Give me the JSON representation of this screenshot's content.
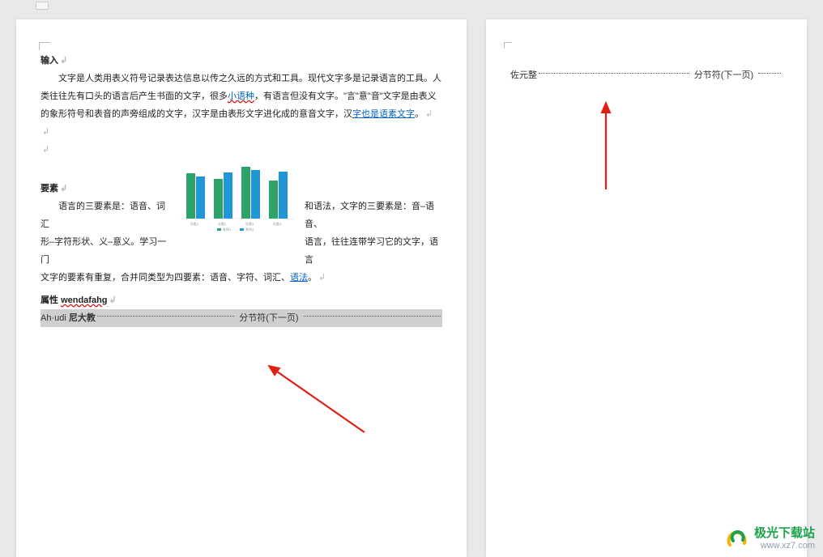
{
  "page1": {
    "heading1": "输入",
    "para1_a": "文字是人类用表义符号记录表达信息以传之久远的方式和工具。现代文字多是记录语言的工具。人类往往先有口头的语言后产生书面的文字，很多",
    "para1_link1": "小语种",
    "para1_b": "，有语言但没有文字。\"言\"意\"音\"文字是由表义的象形符号和表音的声旁组成的文字，汉字是由表形文字进化成的意音文字，汉",
    "para1_link2": "字也是语素文字",
    "para1_c": "。",
    "heading2": "要素",
    "leftcol_a": "语言的三要素是：语音、词汇",
    "leftcol_b": "形–字符形状、义–意义。学习一门",
    "rightcol_a": "和语法，文字的三要素是：音–语音、",
    "rightcol_b": "语言，往往连带学习它的文字，语言",
    "after_wrap": "文字的要素有重复，合并同类型为四要素：语音、字符、词汇、",
    "after_wrap_link": "语法",
    "after_wrap_end": "。",
    "attrib_label": "属性",
    "attrib_wavy": "wendafahg",
    "line_prefix": "Ah·udi",
    "line_bold": "尼大教",
    "section_break_label": "分节符(下一页)"
  },
  "page2": {
    "line_prefix": "佐元整",
    "section_break_label": "分节符(下一页)"
  },
  "chart_data": {
    "type": "bar",
    "title": "",
    "xlabel": "",
    "ylabel": "",
    "ylim": [
      0,
      80
    ],
    "categories": [
      "分类1",
      "分类2",
      "分类3",
      "分类4"
    ],
    "series": [
      {
        "name": "系列1",
        "color": "#2da36a",
        "values": [
          60,
          52,
          70,
          50
        ]
      },
      {
        "name": "系列2",
        "color": "#2196d6",
        "values": [
          56,
          62,
          66,
          64
        ]
      }
    ],
    "legend_position": "bottom"
  },
  "watermark": {
    "brand": "极光下载站",
    "url": "www.xz7.com"
  }
}
